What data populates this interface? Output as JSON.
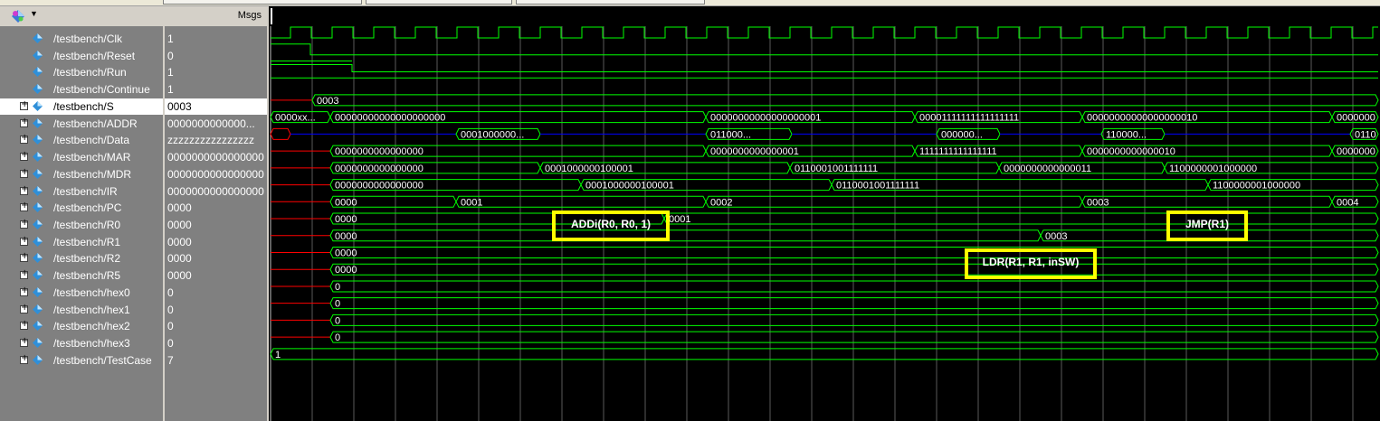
{
  "header": {
    "msgs_label": "Msgs",
    "logo_icon": "wave-logo-icon",
    "dropdown_icon": "chevron-down-icon"
  },
  "colors": {
    "signal": "#00ff00",
    "unknown": "#ff0000",
    "highz": "#0000ff",
    "annotation": "#ffff00"
  },
  "signals": [
    {
      "name": "/testbench/Clk",
      "value": "1",
      "expandable": false,
      "icon": "logic-signal-icon"
    },
    {
      "name": "/testbench/Reset",
      "value": "0",
      "expandable": false,
      "icon": "logic-signal-icon"
    },
    {
      "name": "/testbench/Run",
      "value": "1",
      "expandable": false,
      "icon": "logic-signal-icon"
    },
    {
      "name": "/testbench/Continue",
      "value": "1",
      "expandable": false,
      "icon": "logic-signal-icon"
    },
    {
      "name": "/testbench/S",
      "value": "0003",
      "expandable": true,
      "icon": "bus-signal-icon",
      "selected": true
    },
    {
      "name": "/testbench/ADDR",
      "value": "0000000000000...",
      "expandable": true,
      "icon": "bus-signal-icon"
    },
    {
      "name": "/testbench/Data",
      "value": "zzzzzzzzzzzzzzzz",
      "expandable": true,
      "icon": "bus-signal-icon"
    },
    {
      "name": "/testbench/MAR",
      "value": "0000000000000000",
      "expandable": true,
      "icon": "bus-signal-icon"
    },
    {
      "name": "/testbench/MDR",
      "value": "0000000000000000",
      "expandable": true,
      "icon": "bus-signal-icon"
    },
    {
      "name": "/testbench/IR",
      "value": "0000000000000000",
      "expandable": true,
      "icon": "bus-signal-icon"
    },
    {
      "name": "/testbench/PC",
      "value": "0000",
      "expandable": true,
      "icon": "bus-signal-icon"
    },
    {
      "name": "/testbench/R0",
      "value": "0000",
      "expandable": true,
      "icon": "bus-signal-icon"
    },
    {
      "name": "/testbench/R1",
      "value": "0000",
      "expandable": true,
      "icon": "bus-signal-icon"
    },
    {
      "name": "/testbench/R2",
      "value": "0000",
      "expandable": true,
      "icon": "bus-signal-icon"
    },
    {
      "name": "/testbench/R5",
      "value": "0000",
      "expandable": true,
      "icon": "bus-signal-icon"
    },
    {
      "name": "/testbench/hex0",
      "value": "0",
      "expandable": true,
      "icon": "bus-signal-icon"
    },
    {
      "name": "/testbench/hex1",
      "value": "0",
      "expandable": true,
      "icon": "bus-signal-icon"
    },
    {
      "name": "/testbench/hex2",
      "value": "0",
      "expandable": true,
      "icon": "bus-signal-icon"
    },
    {
      "name": "/testbench/hex3",
      "value": "0",
      "expandable": true,
      "icon": "bus-signal-icon"
    },
    {
      "name": "/testbench/TestCase",
      "value": "7",
      "expandable": true,
      "icon": "bus-signal-icon"
    }
  ],
  "waveform": {
    "bus_labels": {
      "S": [
        "0003"
      ],
      "ADDR": [
        "0000xx...",
        "00000000000000000000",
        "00000000000000000001",
        "00001111111111111111",
        "00000000000000000010",
        "0000000"
      ],
      "Data": [
        "0001000000...",
        "011000...",
        "000000...",
        "110000...",
        "0110"
      ],
      "MAR": [
        "0000000000000000",
        "0000000000000001",
        "1111111111111111",
        "0000000000000010",
        "0000000"
      ],
      "MDR": [
        "0000000000000000",
        "0001000000100001",
        "0110001001111111",
        "0000000000000011",
        "1100000001000000"
      ],
      "IR": [
        "0000000000000000",
        "0001000000100001",
        "0110001001111111",
        "1100000001000000"
      ],
      "PC": [
        "0000",
        "0001",
        "0002",
        "0003",
        "0004"
      ],
      "R0": [
        "0000",
        "0001"
      ],
      "R1": [
        "0000",
        "0003"
      ],
      "R2": [
        "0000"
      ],
      "R5": [
        "0000"
      ],
      "hex0": [
        "0"
      ],
      "hex1": [
        "0"
      ],
      "hex2": [
        "0"
      ],
      "hex3": [
        "0"
      ],
      "TestCase": [
        "1"
      ]
    }
  },
  "annotations": [
    {
      "text": "ADDi(R0, R0, 1)"
    },
    {
      "text": "JMP(R1)"
    },
    {
      "text": "LDR(R1, R1, inSW)"
    }
  ]
}
